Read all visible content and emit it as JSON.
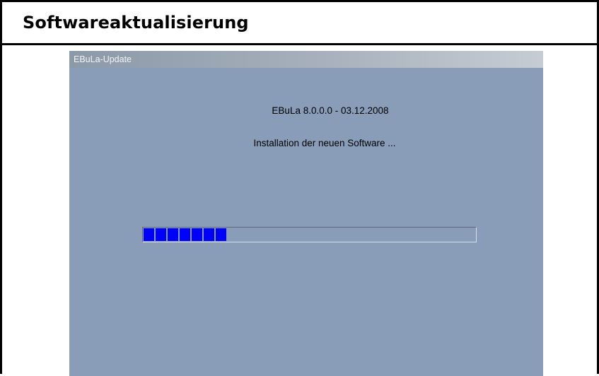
{
  "page": {
    "title": "Softwareaktualisierung"
  },
  "window": {
    "title": "EBuLa-Update",
    "app_version": "EBuLa 8.0.0.0 - 03.12.2008",
    "status_text": "Installation der neuen Software ...",
    "progress": {
      "blocks_filled": 7,
      "fraction": 0.25,
      "fill_color": "#0000ff"
    }
  },
  "colors": {
    "window_background": "#8a9db8",
    "titlebar_start": "#8c99a8",
    "titlebar_end": "#c6ccd4"
  }
}
